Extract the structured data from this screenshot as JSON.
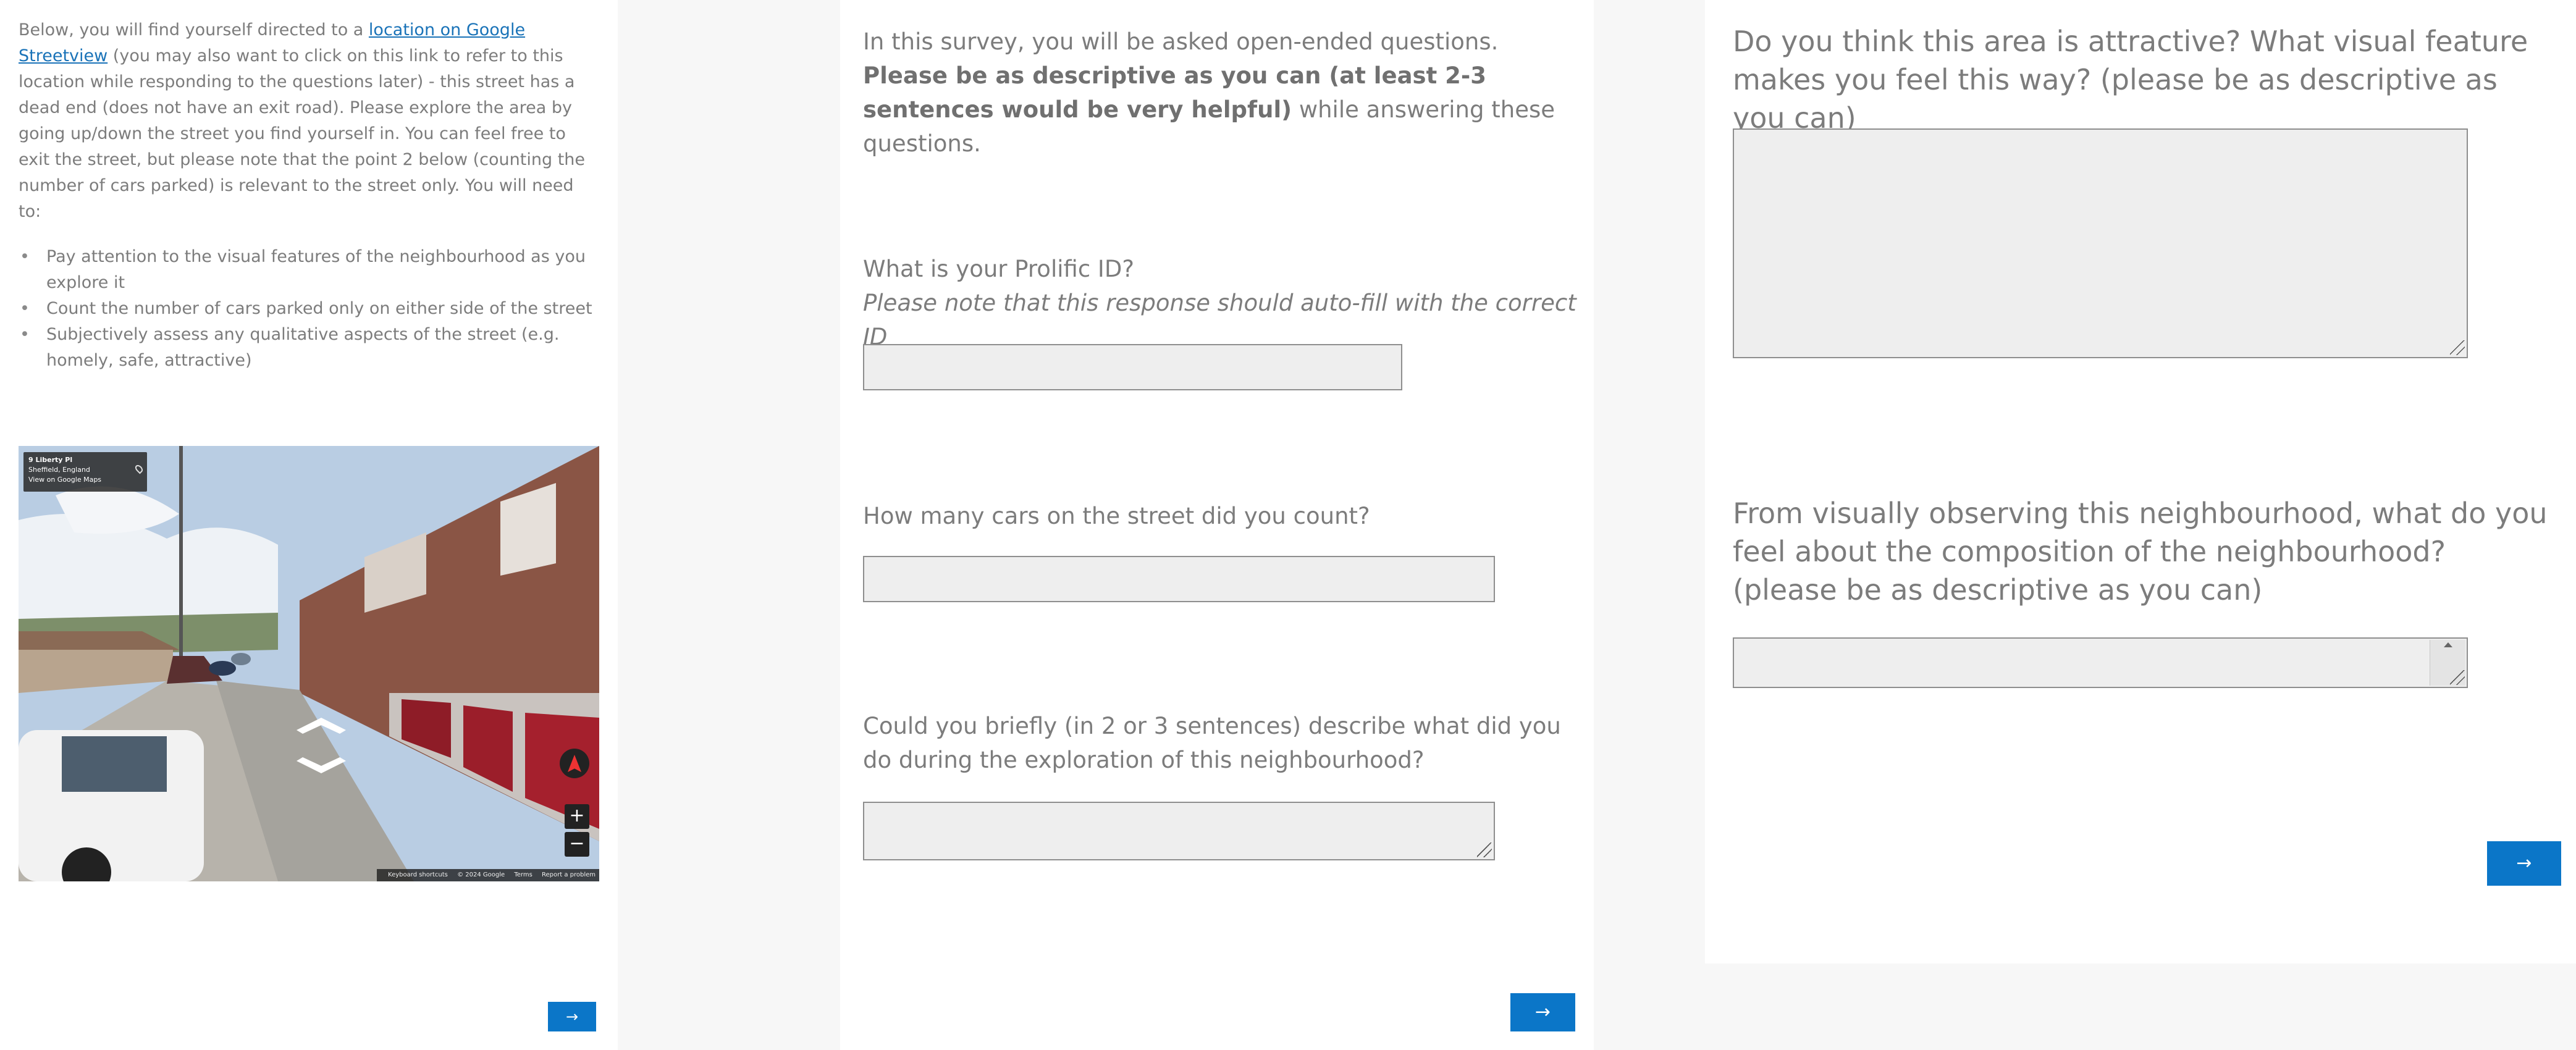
{
  "panel1": {
    "intro_before_link": "Below, you will find yourself directed to a ",
    "link_text": "location on Google Streetview",
    "intro_after_link": " (you may also want to click on this link to refer to this location while responding to the questions later) - this street has a dead end (does not have an exit road). Please explore the area by going up/down the street you find yourself in. You can feel free to exit the street, but please note that the point 2 below (counting the number of cars parked) is relevant to the street only. You will need to:",
    "bullets": [
      "Pay attention to the visual features of the neighbourhood as you explore it",
      "Count the number of cars parked only on either side of the street",
      "Subjectively assess any qualitative aspects of the street (e.g. homely, safe, attractive)"
    ],
    "streetview": {
      "place_name": "9 Liberty Pl",
      "region": "Sheffield, England",
      "view_link": "View on Google Maps",
      "zoom_in": "+",
      "zoom_out": "−",
      "footer": [
        "Keyboard shortcuts",
        "© 2024 Google",
        "Terms",
        "Report a problem"
      ]
    },
    "next_label": "→"
  },
  "panel2": {
    "intro_plain": "In this survey, you will be asked open-ended questions. ",
    "intro_bold": "Please be as descriptive as you can (at least 2-3 sentences would be very helpful)",
    "intro_tail": " while answering these questions.",
    "q_prolific": "What is your Prolific ID?",
    "q_prolific_note": "Please note that this response should auto-fill with the correct ID",
    "q_cars": "How many cars on the street did you count?",
    "q_describe": "Could you briefly (in 2 or 3 sentences) describe what did you do during the exploration of this neighbourhood?",
    "next_label": "→"
  },
  "panel3": {
    "q_attractive": "Do you think this area is attractive? What visual feature makes you feel this way? (please be as descriptive as you can)",
    "q_composition": "From visually observing this neighbourhood, what do you feel about the composition of the neighbourhood? (please be as descriptive as you can)",
    "next_label": "→"
  },
  "colors": {
    "accent": "#0b76c8",
    "text": "#7c7c7c",
    "field_bg": "#eeeeee",
    "field_border": "#8e8e8e"
  }
}
